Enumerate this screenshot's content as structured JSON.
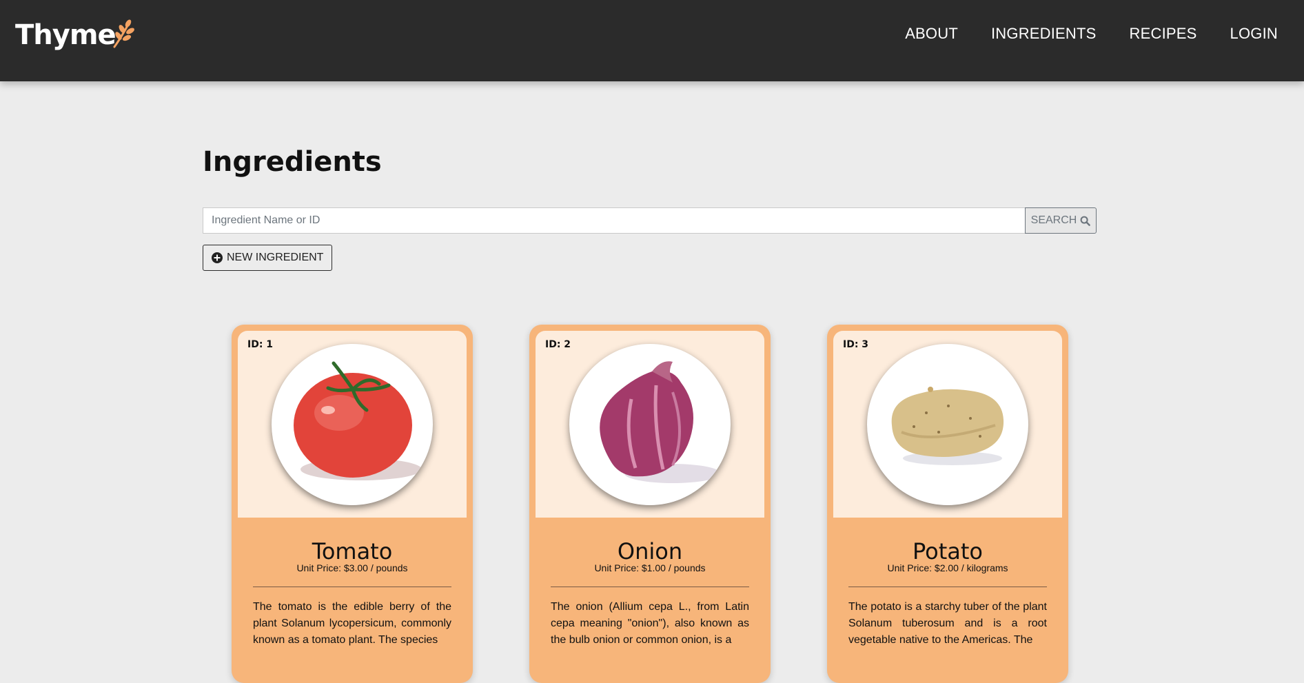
{
  "header": {
    "brand": "Thyme",
    "nav": [
      "ABOUT",
      "INGREDIENTS",
      "RECIPES",
      "LOGIN"
    ]
  },
  "main": {
    "title": "Ingredients",
    "search": {
      "placeholder": "Ingredient Name or ID",
      "value": "",
      "button_label": "SEARCH"
    },
    "new_button_label": "NEW INGREDIENT"
  },
  "cards": [
    {
      "id_label": "ID: 1",
      "name": "Tomato",
      "price": "Unit Price: $3.00 / pounds",
      "description": "The tomato is the edible berry of the plant Solanum lycopersicum, commonly known as a tomato plant. The species",
      "image": "tomato-illustration"
    },
    {
      "id_label": "ID: 2",
      "name": "Onion",
      "price": "Unit Price: $1.00 / pounds",
      "description": "The onion (Allium cepa L., from Latin cepa meaning \"onion\"), also known as the bulb onion or common onion, is a",
      "image": "onion-illustration"
    },
    {
      "id_label": "ID: 3",
      "name": "Potato",
      "price": "Unit Price: $2.00 / kilograms",
      "description": "The potato is a starchy tuber of the plant Solanum tuberosum and is a root vegetable native to the Americas. The",
      "image": "potato-illustration"
    }
  ],
  "colors": {
    "header_bg": "#2b2b2b",
    "page_bg": "#ececec",
    "accent": "#f4a261",
    "card_bg": "#f7b57a",
    "card_top_bg": "#fdecdc"
  }
}
